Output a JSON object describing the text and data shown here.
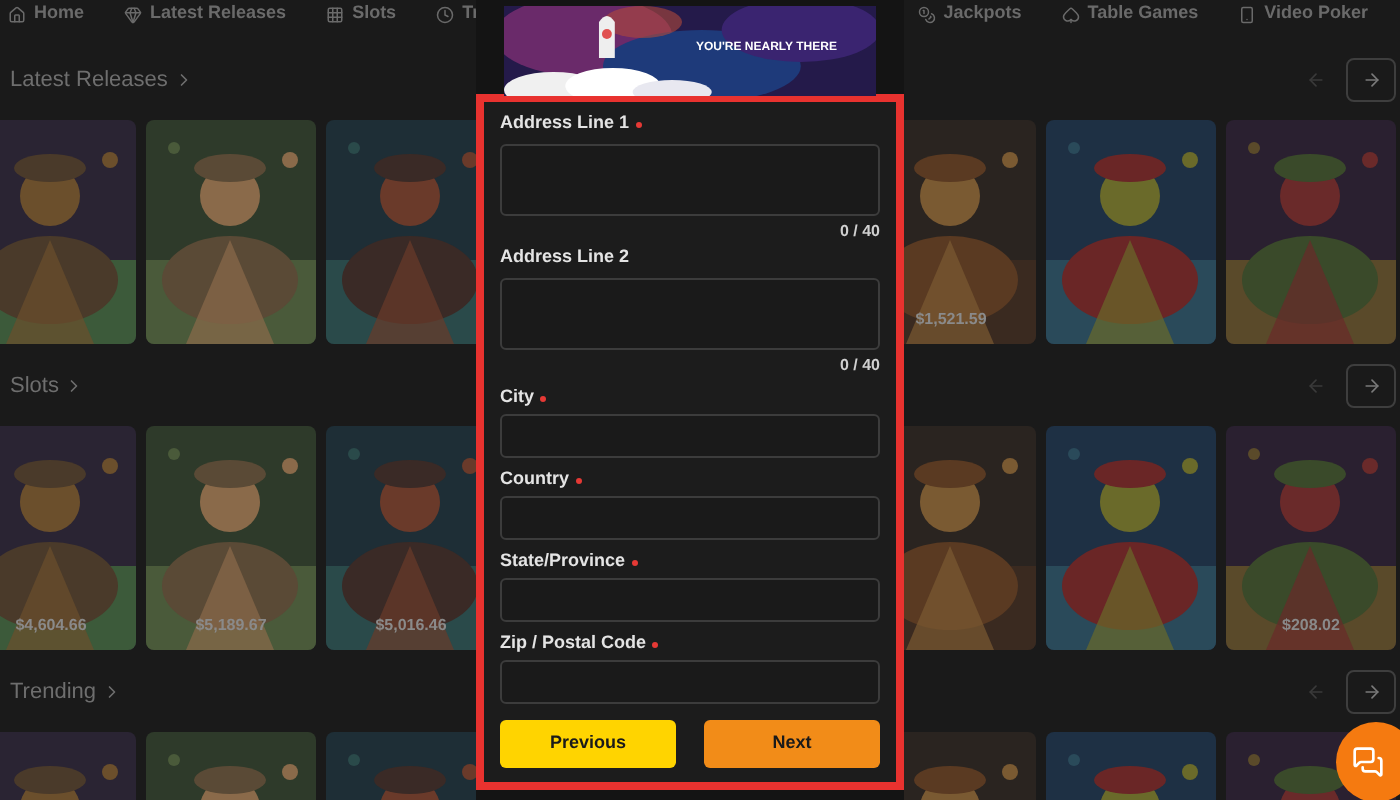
{
  "nav": [
    {
      "label": "Home"
    },
    {
      "label": "Latest Releases"
    },
    {
      "label": "Slots"
    },
    {
      "label": "Tr"
    },
    {
      "label": "Jackpots"
    },
    {
      "label": "Table Games"
    },
    {
      "label": "Video Poker"
    }
  ],
  "sections": [
    {
      "title": "Latest Releases",
      "tiles": [
        {
          "kind": "picture"
        },
        {
          "kind": "picture"
        },
        {
          "kind": "picture"
        },
        {
          "kind": "picture",
          "price": "$1,521.59"
        },
        {
          "kind": "picture"
        },
        {
          "kind": "picture"
        }
      ]
    },
    {
      "title": "Slots",
      "tiles": [
        {
          "kind": "picture",
          "price": "$4,604.66"
        },
        {
          "kind": "picture",
          "price": "$5,189.67"
        },
        {
          "kind": "picture",
          "price": "$5,016.46"
        },
        {
          "kind": "picture"
        },
        {
          "kind": "picture"
        },
        {
          "kind": "picture",
          "price": "$208.02"
        }
      ]
    },
    {
      "title": "Trending",
      "tiles": [
        {
          "kind": "picture"
        },
        {
          "kind": "picture"
        },
        {
          "kind": "picture"
        },
        {
          "kind": "picture"
        },
        {
          "kind": "picture"
        },
        {
          "kind": "picture"
        }
      ]
    }
  ],
  "dialog": {
    "banner": {
      "text": "YOU'RE NEARLY THERE"
    },
    "fields": [
      {
        "label": "Address Line 1",
        "required": true,
        "kind": "textarea",
        "counter": "0 / 40"
      },
      {
        "label": "Address Line 2",
        "required": false,
        "kind": "textarea",
        "counter": "0 / 40"
      },
      {
        "label": "City",
        "required": true,
        "kind": "input"
      },
      {
        "label": "Country",
        "required": true,
        "kind": "input"
      },
      {
        "label": "State/Province",
        "required": true,
        "kind": "input"
      },
      {
        "label": "Zip / Postal Code",
        "required": true,
        "kind": "input"
      }
    ],
    "buttons": [
      {
        "label": "Previous",
        "kind": "back"
      },
      {
        "label": "Next",
        "kind": "forward"
      }
    ]
  }
}
